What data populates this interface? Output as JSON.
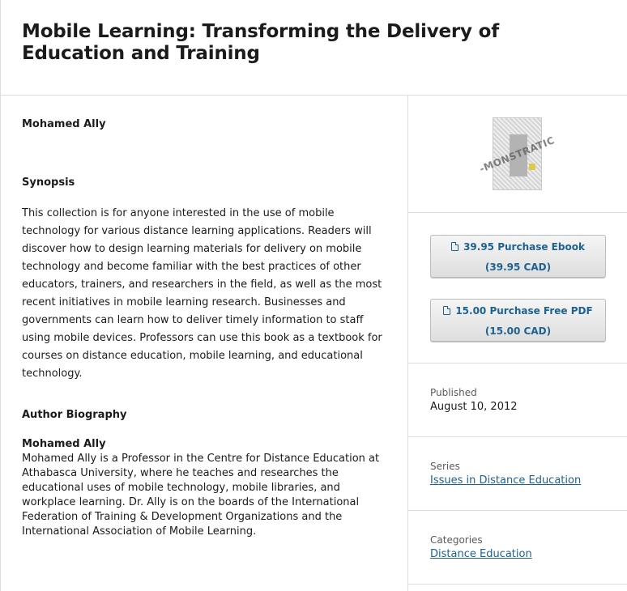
{
  "header": {
    "title": "Mobile Learning: Transforming the Delivery of Education and Training"
  },
  "main": {
    "author": "Mohamed Ally",
    "synopsis_heading": "Synopsis",
    "synopsis_text": "This collection is for anyone interested in the use of mobile technology for various distance learning applications. Readers will discover how to design learning materials for delivery on mobile technology and become familiar with the best practices of other educators, trainers, and researchers in the field, as well as the most recent initiatives in mobile learning research. Businesses and governments can learn how to deliver timely information to staff using mobile devices. Professors can use this book as a textbook for courses on distance education, mobile learning, and educational technology.",
    "bio_heading": "Author Biography",
    "bio_name": "Mohamed Ally",
    "bio_text": "Mohamed Ally is a Professor in the Centre for Distance Education at Athabasca University, where he teaches and researches the educational uses of mobile technology, mobile libraries, and workplace learning. Dr. Ally is on the boards of the International Federation of Training & Development Organizations and the International Association of Mobile Learning."
  },
  "sidebar": {
    "cover": {
      "watermark": "-MONSTRATIC"
    },
    "purchase": [
      {
        "label": "39.95 Purchase Ebook (39.95 CAD)",
        "icon": "pdf-file-icon"
      },
      {
        "label": "15.00 Purchase Free PDF (15.00 CAD)",
        "icon": "pdf-file-icon"
      }
    ],
    "published": {
      "label": "Published",
      "value": "August 10, 2012"
    },
    "series": {
      "label": "Series",
      "value": "Issues in Distance Education"
    },
    "categories": {
      "label": "Categories",
      "value": "Distance Education"
    }
  },
  "colors": {
    "link": "#1e6292",
    "text": "#1b1b1b",
    "muted": "#5b5b5b",
    "border": "#dddddd"
  }
}
